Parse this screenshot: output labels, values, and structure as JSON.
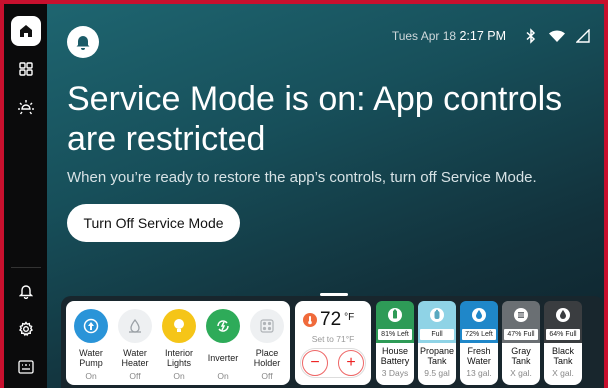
{
  "colors": {
    "alert_border": "#c8102e",
    "battery_top": "#2e9b57",
    "propane_top": "#8fd3e6",
    "fresh_top": "#1f87c9",
    "gray_top": "#6a6f73",
    "black_top": "#3a3d40",
    "water_pump": "#2a94d8",
    "interior_lights": "#f5c518",
    "inverter": "#2eab59"
  },
  "sidebar": {
    "items": [
      {
        "icon": "home-icon"
      },
      {
        "icon": "grid-icon"
      },
      {
        "icon": "sun-icon"
      },
      {
        "icon": "bell-icon"
      },
      {
        "icon": "gear-icon"
      },
      {
        "icon": "keyboard-icon"
      }
    ]
  },
  "status": {
    "date": "Tues Apr 18",
    "time": "2:17 PM",
    "icons": [
      "bluetooth-icon",
      "wifi-icon",
      "signal-icon"
    ]
  },
  "banner": {
    "title": "Service Mode is on: App controls are restricted",
    "subtitle": "When you’re ready to restore the app’s controls, turn off Service Mode.",
    "button_label": "Turn Off Service Mode"
  },
  "controls": [
    {
      "label": "Water Pump",
      "state": "On",
      "icon": "water-pump-icon"
    },
    {
      "label": "Water Heater",
      "state": "Off",
      "icon": "water-heater-icon"
    },
    {
      "label": "Interior Lights",
      "state": "On",
      "icon": "lightbulb-icon"
    },
    {
      "label": "Inverter",
      "state": "On",
      "icon": "inverter-icon"
    },
    {
      "label": "Place Holder",
      "state": "Off",
      "icon": "placeholder-icon"
    }
  ],
  "thermostat": {
    "temp": "72",
    "unit": "°F",
    "setpoint": "Set to 71°F",
    "minus": "−",
    "plus": "+"
  },
  "tanks": [
    {
      "name": "House Battery",
      "level": "81% Left",
      "sub": "3 Days",
      "icon": "battery-icon"
    },
    {
      "name": "Propane Tank",
      "level": "Full",
      "sub": "9.5 gal",
      "icon": "propane-icon"
    },
    {
      "name": "Fresh Water",
      "level": "72% Left",
      "sub": "13 gal.",
      "icon": "water-drop-icon"
    },
    {
      "name": "Gray Tank",
      "level": "47% Full",
      "sub": "X gal.",
      "icon": "gray-tank-icon"
    },
    {
      "name": "Black Tank",
      "level": "64% Full",
      "sub": "X gal.",
      "icon": "black-tank-icon"
    }
  ]
}
